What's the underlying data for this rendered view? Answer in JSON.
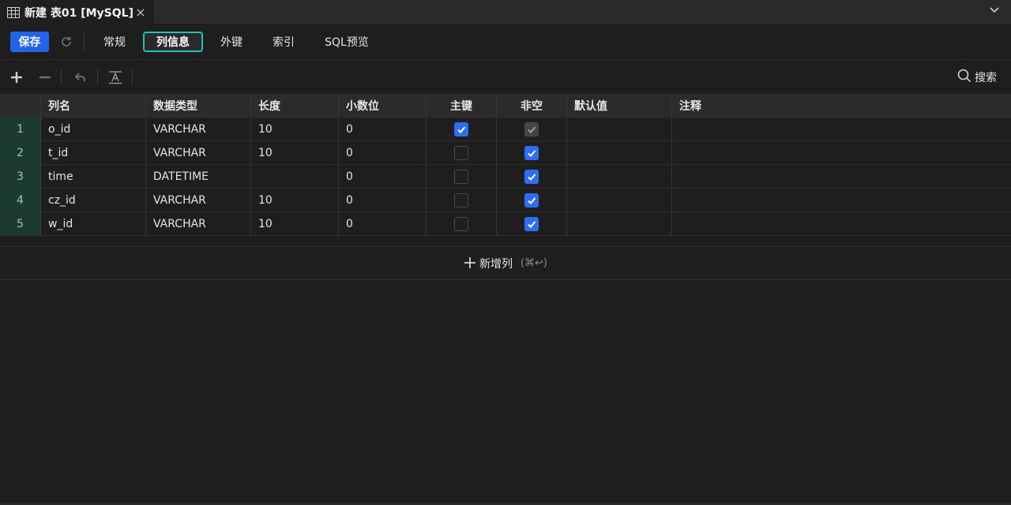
{
  "tab": {
    "title": "新建 表01 [MySQL]",
    "close": "×"
  },
  "toolbar": {
    "save_label": "保存",
    "tabs": [
      {
        "label": "常规"
      },
      {
        "label": "列信息",
        "active": true
      },
      {
        "label": "外键"
      },
      {
        "label": "索引"
      },
      {
        "label": "SQL预览"
      }
    ]
  },
  "actions": {
    "search_label": "搜索"
  },
  "grid": {
    "columns": [
      "列名",
      "数据类型",
      "长度",
      "小数位",
      "主键",
      "非空",
      "默认值",
      "注释"
    ],
    "rows": [
      {
        "num": "1",
        "name": "o_id",
        "type": "VARCHAR",
        "length": "10",
        "decimals": "0",
        "primary_key": "checked",
        "not_null": "checked-disabled",
        "default": "",
        "comment": ""
      },
      {
        "num": "2",
        "name": "t_id",
        "type": "VARCHAR",
        "length": "10",
        "decimals": "0",
        "primary_key": "unchecked",
        "not_null": "checked",
        "default": "",
        "comment": ""
      },
      {
        "num": "3",
        "name": "time",
        "type": "DATETIME",
        "length": "",
        "decimals": "0",
        "primary_key": "unchecked",
        "not_null": "checked",
        "default": "",
        "comment": ""
      },
      {
        "num": "4",
        "name": "cz_id",
        "type": "VARCHAR",
        "length": "10",
        "decimals": "0",
        "primary_key": "unchecked",
        "not_null": "checked",
        "default": "",
        "comment": ""
      },
      {
        "num": "5",
        "name": "w_id",
        "type": "VARCHAR",
        "length": "10",
        "decimals": "0",
        "primary_key": "unchecked",
        "not_null": "checked",
        "default": "",
        "comment": ""
      }
    ]
  },
  "add_column": {
    "label": "新增列",
    "shortcut": "(⌘↩)"
  },
  "colors": {
    "accent": "#2364e6",
    "active_tab_border": "#1ec2b8",
    "checkbox": "#2d6ff0",
    "row_number_bg": "#1b3b2e"
  }
}
